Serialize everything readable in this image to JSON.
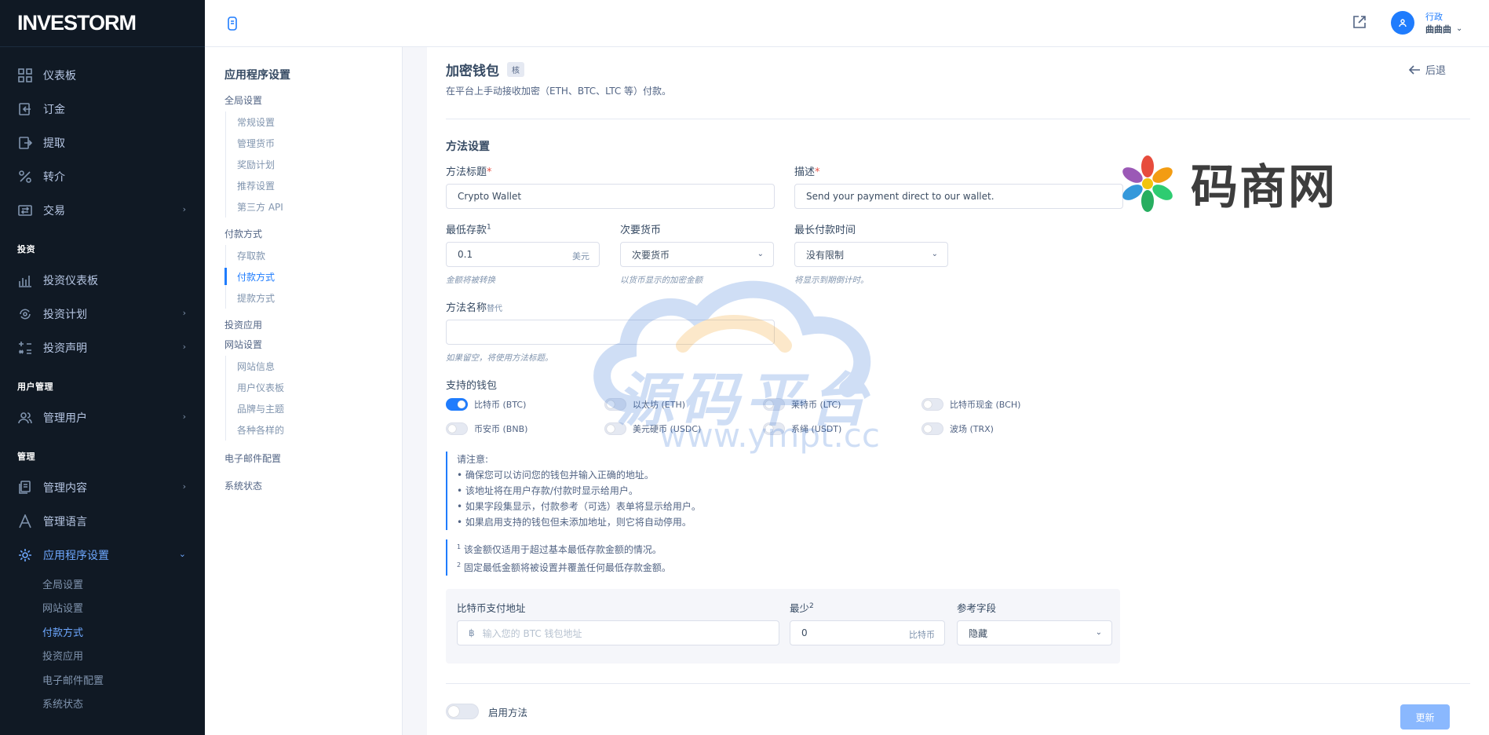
{
  "brand": "INVESTORM",
  "sidebar": {
    "items": [
      {
        "label": "仪表板",
        "icon": "grid-icon"
      },
      {
        "label": "订金",
        "icon": "deposit-icon"
      },
      {
        "label": "提取",
        "icon": "withdraw-icon"
      },
      {
        "label": "转介",
        "icon": "percent-icon"
      },
      {
        "label": "交易",
        "icon": "exchange-icon"
      }
    ],
    "invest_title": "投资",
    "invest_items": [
      {
        "label": "投资仪表板"
      },
      {
        "label": "投资计划"
      },
      {
        "label": "投资声明"
      }
    ],
    "user_title": "用户管理",
    "user_items": [
      {
        "label": "管理用户"
      }
    ],
    "manage_title": "管理",
    "manage_items": [
      {
        "label": "管理内容"
      },
      {
        "label": "管理语言"
      },
      {
        "label": "应用程序设置"
      }
    ],
    "sub_items": [
      "全局设置",
      "网站设置",
      "付款方式",
      "投资应用",
      "电子邮件配置",
      "系统状态"
    ]
  },
  "topbar": {
    "user_role": "行政",
    "user_name": "曲曲曲"
  },
  "settings_nav": {
    "title": "应用程序设置",
    "global": "全局设置",
    "global_items": [
      "常规设置",
      "管理货币",
      "奖励计划",
      "推荐设置",
      "第三方 API"
    ],
    "payment": "付款方式",
    "payment_items": [
      "存取款",
      "付款方式",
      "提款方式"
    ],
    "invest_app": "投资应用",
    "website": "网站设置",
    "website_items": [
      "网站信息",
      "用户仪表板",
      "品牌与主题",
      "各种各样的"
    ],
    "email": "电子邮件配置",
    "status": "系统状态"
  },
  "page": {
    "title": "加密钱包",
    "tag": "核",
    "subtitle": "在平台上手动接收加密（ETH、BTC、LTC 等）付款。",
    "back": "后退",
    "section": "方法设置",
    "method_title_label": "方法标题",
    "method_title_value": "Crypto Wallet",
    "desc_label": "描述",
    "desc_value": "Send your payment direct to our wallet.",
    "min_deposit_label": "最低存款",
    "min_deposit_value": "0.1",
    "min_deposit_unit": "美元",
    "min_deposit_hint": "金额将被转换",
    "secondary_label": "次要货币",
    "secondary_value": "次要货币",
    "secondary_hint": "以货币显示的加密金额",
    "max_time_label": "最长付款时间",
    "max_time_value": "没有限制",
    "max_time_hint": "将显示到期倒计时。",
    "alt_name_label": "方法名称",
    "alt_name_suffix": "替代",
    "alt_name_hint": "如果留空，将使用方法标题。",
    "wallets_label": "支持的钱包",
    "wallets": [
      {
        "label": "比特币 (BTC)",
        "on": true
      },
      {
        "label": "以太坊 (ETH)",
        "on": false
      },
      {
        "label": "莱特币 (LTC)",
        "on": false
      },
      {
        "label": "比特币现金 (BCH)",
        "on": false
      },
      {
        "label": "币安币 (BNB)",
        "on": false
      },
      {
        "label": "美元硬币 (USDC)",
        "on": false
      },
      {
        "label": "系绳 (USDT)",
        "on": false
      },
      {
        "label": "波场 (TRX)",
        "on": false
      }
    ],
    "note_title": "请注意:",
    "notes": [
      "• 确保您可以访问您的钱包并输入正确的地址。",
      "• 该地址将在用户存款/付款时显示给用户。",
      "• 如果字段集显示，付款参考（可选）表单将显示给用户。",
      "• 如果启用支持的钱包但未添加地址，则它将自动停用。"
    ],
    "footnote1": "该金额仅适用于超过基本最低存款金额的情况。",
    "footnote2": "固定最低金额将被设置并覆盖任何最低存款金额。",
    "btc_addr_label": "比特币支付地址",
    "btc_addr_placeholder": "输入您的 BTC 钱包地址",
    "btc_symbol": "฿",
    "min_label": "最少",
    "min_value": "0",
    "min_unit": "比特币",
    "ref_label": "参考字段",
    "ref_value": "隐藏",
    "enable_label": "启用方法",
    "update": "更新"
  },
  "watermark": {
    "logo_text": "码商网",
    "center_text": "源码平台",
    "center_url": "www.ympt.cc"
  }
}
